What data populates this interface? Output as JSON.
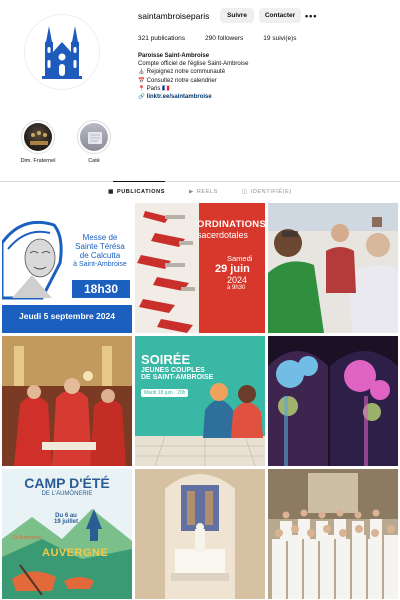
{
  "profile": {
    "username": "saintambroiseparis",
    "follow_label": "Suivre",
    "contact_label": "Contacter",
    "more_label": "•••",
    "stats": {
      "posts": "321 publications",
      "followers": "290 followers",
      "following": "19 suivi(e)s"
    },
    "bio": {
      "name": "Paroisse Saint-Ambroise",
      "line1": "Compte officiel de l'église Saint-Ambroise",
      "line2": "Rejoignez notre communauté",
      "line3": "Consultez notre calendrier",
      "line4": "Paris 🇫🇷",
      "link": "linktr.ee/saintambroise"
    }
  },
  "highlights": [
    {
      "label": "Dim. Fraternel"
    },
    {
      "label": "Caté"
    }
  ],
  "tabs": [
    {
      "label": "PUBLICATIONS"
    },
    {
      "label": "REELS"
    },
    {
      "label": "IDENTIFIÉ(E)"
    }
  ],
  "posts": {
    "p1": {
      "title1": "Messe de",
      "title2": "Sainte Térésa",
      "title3": "de Calcutta",
      "title4": "à Saint-Ambroise",
      "time": "18h30",
      "date": "Jeudi 5 septembre 2024"
    },
    "p2": {
      "title1": "ORDINATIONS",
      "title2": "sacerdotales",
      "day": "Samedi",
      "date": "29 juin",
      "year": "2024",
      "time": "à 9h30"
    },
    "p5": {
      "title1": "SOIRÉE",
      "title2": "JEUNES COUPLES",
      "title3": "DE SAINT-AMBROISE",
      "date": "Mardi 18 juin · 20h"
    },
    "p7": {
      "title1": "CAMP D'ÉTÉ",
      "title2": "DE L'AUMÔNERIE",
      "dates1": "Du 6 au",
      "dates2": "19 juillet",
      "region": "AUVERGNE",
      "brand": "St Ambroise"
    }
  },
  "colors": {
    "button_bg": "#efefef",
    "link": "#00376b",
    "blue_post": "#1b5fbf",
    "red_post": "#d8372b",
    "teal_post": "#39b8a5"
  }
}
